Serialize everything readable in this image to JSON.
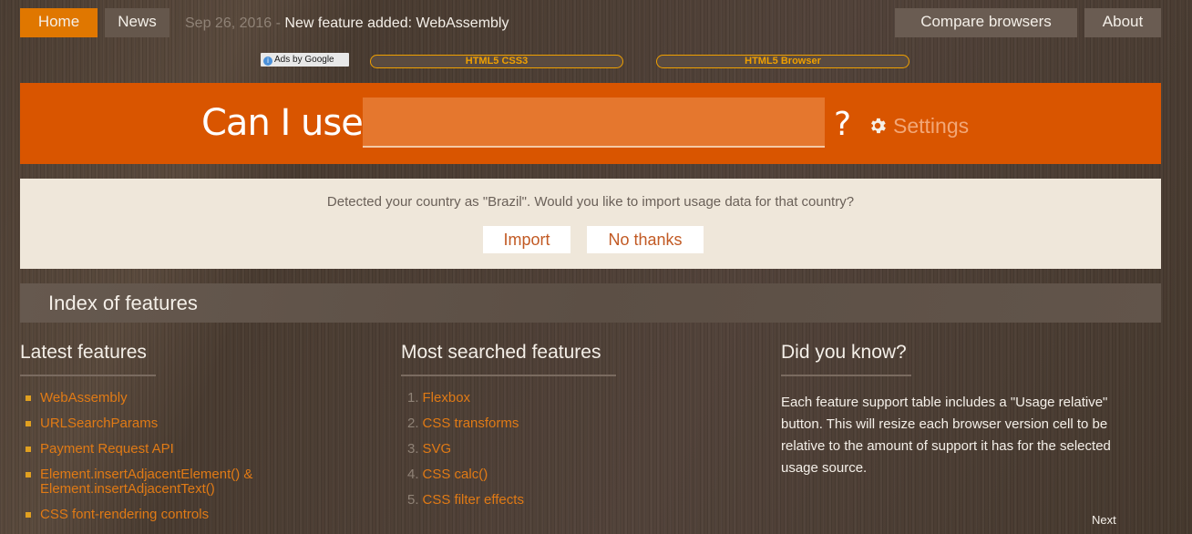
{
  "nav": {
    "home_label": "Home",
    "news_label": "News",
    "news_date": "Sep 26, 2016",
    "news_separator": " - ",
    "news_text": "New feature added: WebAssembly",
    "compare_label": "Compare browsers",
    "about_label": "About"
  },
  "ads": {
    "ads_by_label": "Ads by Google",
    "ad_links": [
      "HTML5 CSS3",
      "HTML5 Browser"
    ]
  },
  "search": {
    "prefix": "Can I use",
    "value": "",
    "suffix": "?",
    "settings_label": "Settings",
    "accent_color": "#d95500"
  },
  "notice": {
    "text": "Detected your country as \"Brazil\". Would you like to import usage data for that country?",
    "import_label": "Import",
    "no_thanks_label": "No thanks"
  },
  "index": {
    "title": "Index of features"
  },
  "latest": {
    "title": "Latest features",
    "items": [
      "WebAssembly",
      "URLSearchParams",
      "Payment Request API",
      "Element.insertAdjacentElement() & Element.insertAdjacentText()",
      "CSS font-rendering controls"
    ]
  },
  "most_searched": {
    "title": "Most searched features",
    "items": [
      {
        "num": "1.",
        "label": "Flexbox"
      },
      {
        "num": "2.",
        "label": "CSS transforms"
      },
      {
        "num": "3.",
        "label": "SVG"
      },
      {
        "num": "4.",
        "label": "CSS calc()"
      },
      {
        "num": "5.",
        "label": "CSS filter effects"
      }
    ]
  },
  "did_you_know": {
    "title": "Did you know?",
    "text": "Each feature support table includes a \"Usage relative\" button. This will resize each browser version cell to be relative to the amount of support it has for the selected usage source.",
    "next_label": "Next"
  },
  "icons": {
    "settings": "gear-icon",
    "ads_info": "info-icon",
    "latest_bullet": "square-bullet-icon"
  }
}
